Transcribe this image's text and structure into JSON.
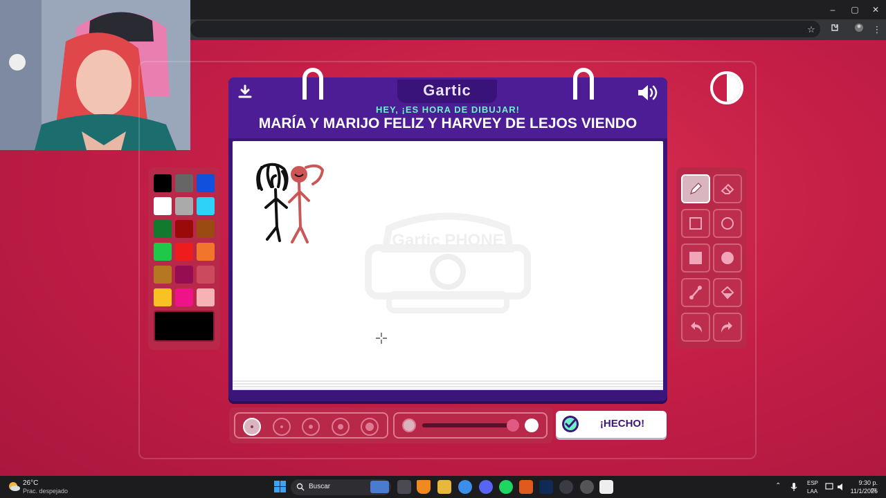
{
  "window_controls": [
    "–",
    "▢",
    "✕"
  ],
  "header": {
    "logo": "Gartic",
    "subtitle": "HEY, ¡ES HORA DE DIBUJAR!",
    "prompt": "MARÍA Y MARIJO FELIZ Y HARVEY DE LEJOS VIENDO"
  },
  "watermark": "Gartic PHONE",
  "palette": {
    "colors": [
      "#000000",
      "#666666",
      "#1050dc",
      "#ffffff",
      "#aaaaaa",
      "#2cd2f8",
      "#117a2d",
      "#9a0a0a",
      "#9a4a13",
      "#1fc848",
      "#ee1c1c",
      "#f1752b",
      "#b57721",
      "#960e51",
      "#cc4a5e",
      "#f8c225",
      "#ef1389",
      "#f7b3b3"
    ],
    "current": "#000000"
  },
  "tools": [
    "pencil-tool",
    "eraser-tool",
    "rectangle-outline-tool",
    "circle-outline-tool",
    "rectangle-fill-tool",
    "circle-fill-tool",
    "line-tool",
    "bucket-tool",
    "undo-tool",
    "redo-tool"
  ],
  "actions": {
    "done_label": "¡HECHO!"
  },
  "opacity_fraction": 1.0,
  "taskbar": {
    "weather_temp": "26°C",
    "weather_desc": "Prac. despejado",
    "search_placeholder": "Buscar",
    "lang_top": "ESP",
    "lang_bottom": "LAA",
    "time": "9:30 p. m.",
    "date": "11/1/2026"
  }
}
